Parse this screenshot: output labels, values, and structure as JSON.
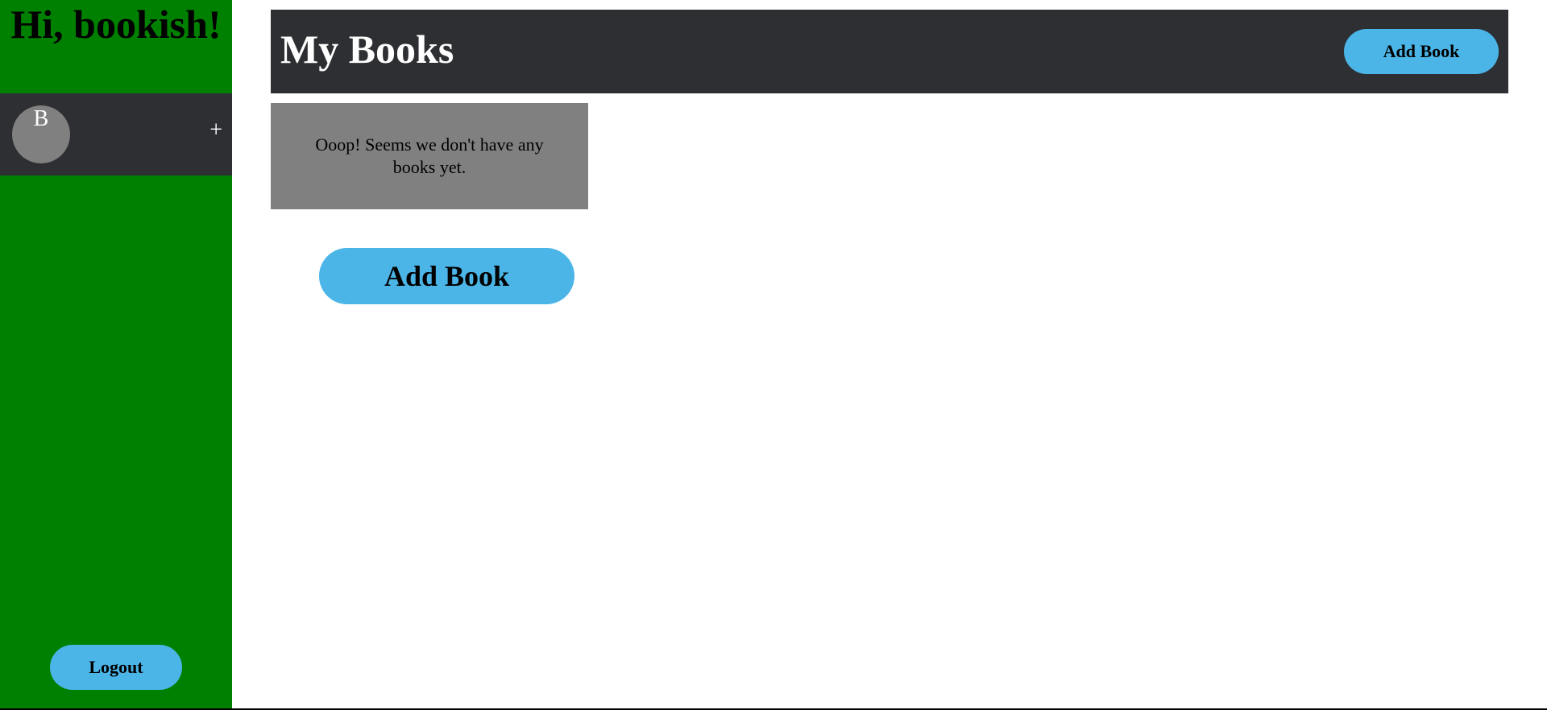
{
  "sidebar": {
    "greeting": "Hi, bookish!",
    "user": {
      "avatar_initial": "B",
      "add_icon": "plus-icon",
      "add_glyph": "+"
    },
    "logout_label": "Logout"
  },
  "header": {
    "title": "My Books",
    "add_button_label": "Add Book"
  },
  "main": {
    "empty_message": "Ooop! Seems we don't have any books yet.",
    "add_button_label": "Add Book"
  },
  "colors": {
    "sidebar_bg": "#008000",
    "bar_bg": "#2e2f33",
    "accent": "#4bb5e8",
    "card_bg": "#808080"
  }
}
